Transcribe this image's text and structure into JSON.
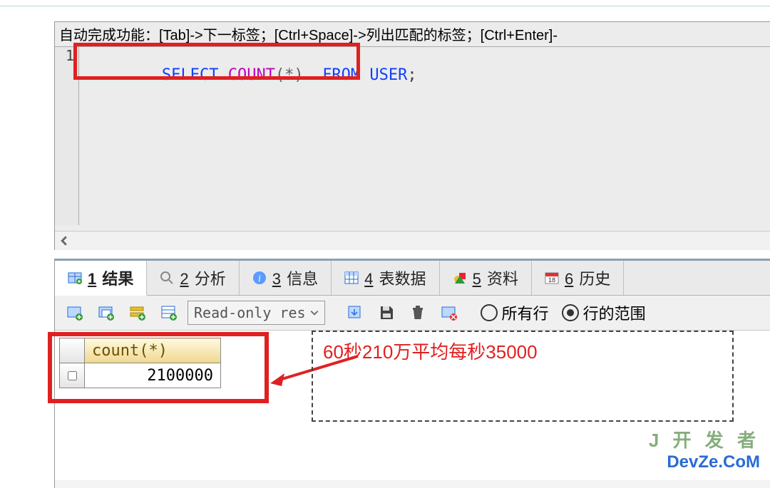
{
  "editor": {
    "hint": "自动完成功能：[Tab]->下一标签；[Ctrl+Space]->列出匹配的标签；[Ctrl+Enter]-",
    "gutter_line": "1",
    "sql": {
      "select": "SELECT",
      "count": "COUNT",
      "star": "(*)",
      "from": "FROM",
      "user": "USER",
      "semi": ";"
    }
  },
  "tabs": [
    {
      "num": "1",
      "label": "结果"
    },
    {
      "num": "2",
      "label": "分析"
    },
    {
      "num": "3",
      "label": "信息"
    },
    {
      "num": "4",
      "label": "表数据"
    },
    {
      "num": "5",
      "label": "资料"
    },
    {
      "num": "6",
      "label": "历史"
    }
  ],
  "toolbar": {
    "readonly": "Read-only res",
    "radio_all": "所有行",
    "radio_range": "行的范围"
  },
  "grid": {
    "col_header": "count(*)",
    "value": "2100000"
  },
  "annotation": "60秒210万平均每秒35000",
  "watermark": {
    "line1": "J 开 发 者",
    "line2": "DevZe.CoM"
  }
}
